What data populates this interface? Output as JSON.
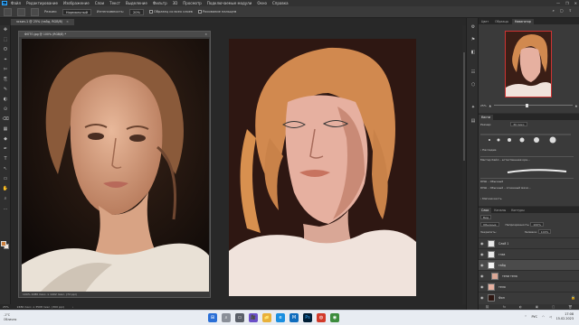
{
  "app": {
    "logo_text": "Ps",
    "menu": [
      "Файл",
      "Редактирование",
      "Изображение",
      "Слои",
      "Текст",
      "Выделение",
      "Фильтр",
      "3D",
      "Просмотр",
      "Подключаемые модули",
      "Окно",
      "Справка"
    ],
    "window_controls": [
      "—",
      "❐",
      "✕"
    ]
  },
  "options_bar": {
    "mode_label": "Режим:",
    "mode_value": "Нормальный",
    "opacity_label": "Непрозр.:",
    "opacity_value": "100%",
    "flow_label": "Нажим:",
    "flow_value": "100%",
    "intensity_label": "Интенсивность:",
    "intensity_value": "20%",
    "sample_all": "Образец со всех слоев",
    "finger_paint": "Рисование пальцем",
    "right_icons": [
      "⌕",
      "▢",
      "⇪"
    ]
  },
  "tabs": [
    {
      "label": "эскиз-1 @ 25% (гайд, RGB/8)",
      "close": "×"
    },
    {
      "label": "ФОТО.jpg @ 100% (RGB/8)",
      "close": "×"
    }
  ],
  "float_window": {
    "title": "ФОТО.jpg @ 100% (RGB/8) *",
    "close": "×",
    "status": "100%    1080 пикс. x 1402 пикс. (72 ppi)"
  },
  "statusbar": {
    "zoom": "25%",
    "info": "2480 пикс. x 3508 пикс. (300 ppi)",
    "arrow": "›"
  },
  "tools": [
    "✥",
    "⬚",
    "ʘ",
    "⌖",
    "✄",
    "⎘",
    "✎",
    "◐",
    "⊙",
    "⌫",
    "▦",
    "◆",
    "✒",
    "T",
    "↖",
    "▭",
    "✋",
    "⌕",
    "…"
  ],
  "colors": {
    "foreground": "#cc7f3c",
    "background": "#f2e7df"
  },
  "side_icons": [
    "⚙",
    "⚑",
    "◧",
    "☷",
    "⬡",
    "✦",
    "▤"
  ],
  "navigator": {
    "tabs": [
      "Цвет",
      "Образцы",
      "Навигатор"
    ],
    "zoom": "25%"
  },
  "brushes": {
    "tabs": [
      "Кисти"
    ],
    "size_label": "Размер:",
    "size_value": "30 пикс.",
    "items": [
      {
        "name": "Наследие"
      },
      {
        "name": "Мастер Кайл – естественная кра..."
      },
      {
        "name": "КУШ – Обычный"
      },
      {
        "name": "КУШ – Обычный – огненный мази..."
      },
      {
        "name": "Мягкая кисть"
      }
    ]
  },
  "layers": {
    "tabs": [
      "Слои",
      "Каналы",
      "Контуры"
    ],
    "kind_label": "Вид",
    "blend_value": "Обычные",
    "opacity_label": "Непрозрачность:",
    "opacity_value": "100%",
    "lock_label": "Закрепить:",
    "fill_label": "Заливка:",
    "fill_value": "100%",
    "items": [
      {
        "name": "Слой 1",
        "selected": false
      },
      {
        "name": "глаз",
        "selected": false
      },
      {
        "name": "гайд",
        "selected": true
      },
      {
        "name": "тени тела",
        "selected": false
      },
      {
        "name": "тело",
        "selected": false
      },
      {
        "name": "Фон",
        "selected": false
      }
    ],
    "footer_icons": [
      "⛓",
      "fx",
      "◐",
      "▣",
      "▢",
      "🗑"
    ]
  },
  "taskbar": {
    "weather": "-1°C",
    "weather_sub": "Облачно",
    "apps": [
      "⊞",
      "⌕",
      "▭",
      "🎥",
      "📁",
      "e",
      "M",
      "Ps",
      "◍",
      "◉"
    ],
    "lang": "РУС",
    "time": "17:08",
    "date": "15.02.2023"
  }
}
